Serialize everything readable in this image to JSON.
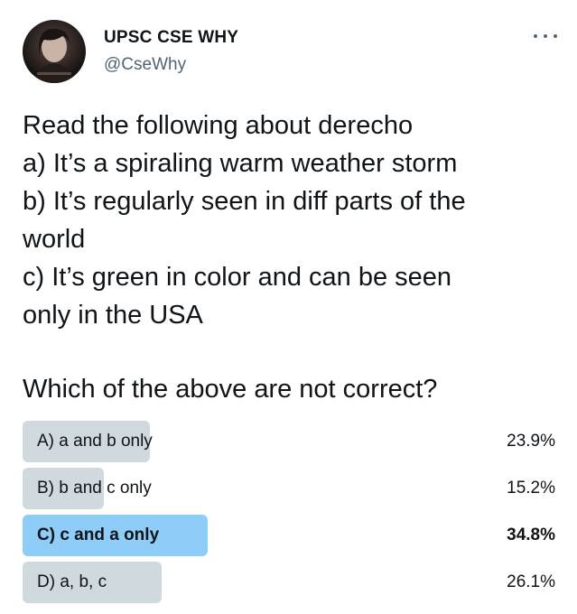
{
  "author": {
    "display_name": "UPSC CSE WHY",
    "handle": "@CseWhy",
    "avatar_icon": "profile-photo"
  },
  "more_icon": "ellipsis-icon",
  "tweet": {
    "lines": [
      "Read the following about derecho",
      "a) It’s a spiraling warm weather storm",
      "b) It’s regularly seen in diff parts of the",
      "world",
      "c) It’s green in color and can be seen",
      "only in the USA"
    ],
    "question": "Which of the above are not correct?"
  },
  "poll": {
    "options": [
      {
        "label": "A) a and b only",
        "percent_text": "23.9%",
        "percent": 23.9,
        "leading": false
      },
      {
        "label": "B) b and c only",
        "percent_text": "15.2%",
        "percent": 15.2,
        "leading": false
      },
      {
        "label": "C) c and a only",
        "percent_text": "34.8%",
        "percent": 34.8,
        "leading": true
      },
      {
        "label": "D) a, b, c",
        "percent_text": "26.1%",
        "percent": 26.1,
        "leading": false
      }
    ],
    "bar_color": "#cfd9de",
    "leading_bar_color": "#8ecdf8"
  }
}
